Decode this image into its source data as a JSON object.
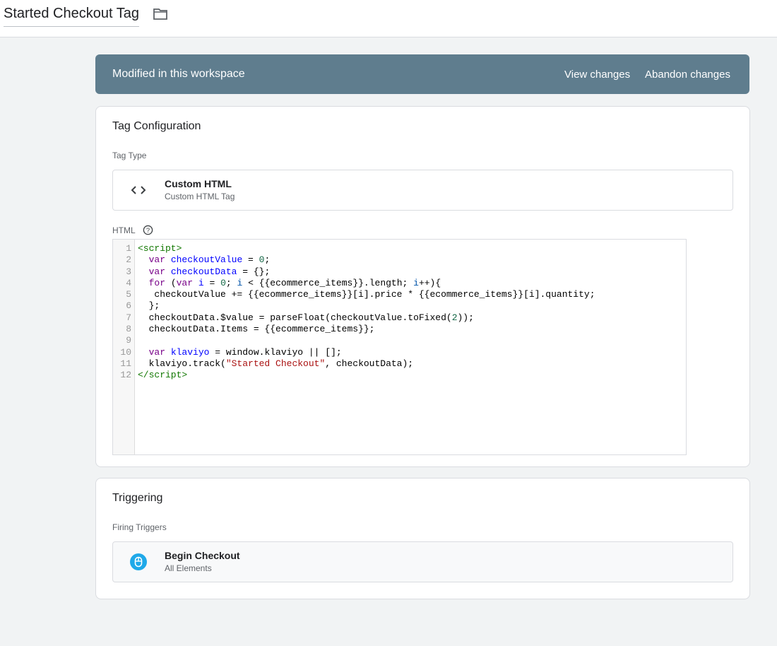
{
  "header": {
    "title": "Started Checkout Tag",
    "folder_icon": "folder-icon"
  },
  "banner": {
    "message": "Modified in this workspace",
    "view_changes": "View changes",
    "abandon_changes": "Abandon changes"
  },
  "tag_config": {
    "title": "Tag Configuration",
    "tag_type_label": "Tag Type",
    "tag_type": {
      "name": "Custom HTML",
      "description": "Custom HTML Tag",
      "icon": "code-brackets-icon"
    },
    "html_label": "HTML",
    "code_lines": [
      [
        {
          "t": "<script>",
          "c": "tag"
        }
      ],
      [
        {
          "t": "  "
        },
        {
          "t": "var",
          "c": "kw"
        },
        {
          "t": " "
        },
        {
          "t": "checkoutValue",
          "c": "def"
        },
        {
          "t": " = "
        },
        {
          "t": "0",
          "c": "num"
        },
        {
          "t": ";"
        }
      ],
      [
        {
          "t": "  "
        },
        {
          "t": "var",
          "c": "kw"
        },
        {
          "t": " "
        },
        {
          "t": "checkoutData",
          "c": "def"
        },
        {
          "t": " = {};"
        }
      ],
      [
        {
          "t": "  "
        },
        {
          "t": "for",
          "c": "kw"
        },
        {
          "t": " ("
        },
        {
          "t": "var",
          "c": "kw"
        },
        {
          "t": " "
        },
        {
          "t": "i",
          "c": "def"
        },
        {
          "t": " = "
        },
        {
          "t": "0",
          "c": "num"
        },
        {
          "t": "; "
        },
        {
          "t": "i",
          "c": "var"
        },
        {
          "t": " < {{ecommerce_items}}.length; "
        },
        {
          "t": "i",
          "c": "var"
        },
        {
          "t": "++){"
        }
      ],
      [
        {
          "t": "   checkoutValue += {{ecommerce_items}}[i].price * {{ecommerce_items}}[i].quantity;"
        }
      ],
      [
        {
          "t": "  };"
        }
      ],
      [
        {
          "t": "  checkoutData.$value = parseFloat(checkoutValue.toFixed("
        },
        {
          "t": "2",
          "c": "num"
        },
        {
          "t": "));"
        }
      ],
      [
        {
          "t": "  checkoutData.Items = {{ecommerce_items}};"
        }
      ],
      [
        {
          "t": ""
        }
      ],
      [
        {
          "t": "  "
        },
        {
          "t": "var",
          "c": "kw"
        },
        {
          "t": " "
        },
        {
          "t": "klaviyo",
          "c": "def"
        },
        {
          "t": " = window.klaviyo || [];"
        }
      ],
      [
        {
          "t": "  klaviyo.track("
        },
        {
          "t": "\"Started Checkout\"",
          "c": "str"
        },
        {
          "t": ", checkoutData);"
        }
      ],
      [
        {
          "t": "</script>",
          "c": "tag"
        }
      ]
    ]
  },
  "triggering": {
    "title": "Triggering",
    "firing_label": "Firing Triggers",
    "trigger": {
      "name": "Begin Checkout",
      "description": "All Elements",
      "icon": "mouse-click-icon",
      "color": "#1fa9e9"
    }
  }
}
